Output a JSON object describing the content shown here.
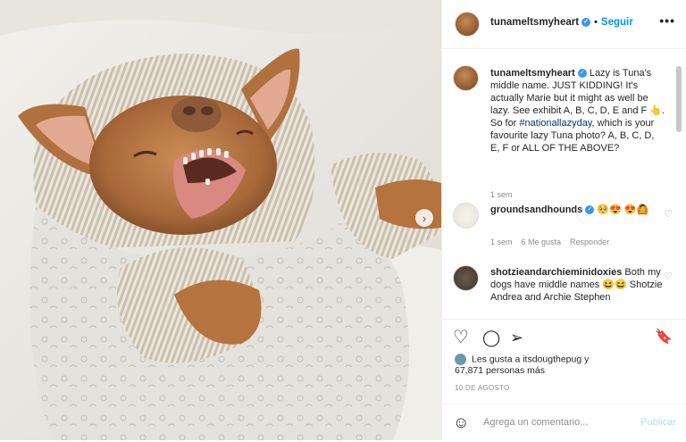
{
  "post": {
    "username": "tunameltsmyheart",
    "follow_label": "Seguir",
    "separator": "•",
    "more": "•••",
    "next_arrow": "›"
  },
  "caption": {
    "username": "tunameltsmyheart",
    "text_before": " Lazy is Tuna's middle name. JUST KIDDING! It's actually Marie but it might as well be lazy. See exhibit A, B, C, D, E and F 👆. So for ",
    "hashtag": "#nationallazyday",
    "text_after": ", which is your favourite lazy Tuna photo? A, B, C, D, E, F or ALL OF THE ABOVE?",
    "time": "1 sem"
  },
  "comments": [
    {
      "username": "groundsandhounds",
      "text": " 🥺😍 😍🙆",
      "time": "1 sem",
      "likes": "6 Me gusta",
      "reply": "Responder"
    },
    {
      "username": "shotzieandarchieminidoxies",
      "text": " Both my dogs have middle names 😆😆 Shotzie Andrea and Archie Stephen"
    }
  ],
  "actions": {
    "heart": "♡",
    "comment": "◯",
    "share": "➢",
    "bookmark": "🔖"
  },
  "likes_line1": "Les gusta a itsdougthepug y",
  "likes_line2": "67,871 personas más",
  "date": "10 DE AGOSTO",
  "add_comment": {
    "placeholder": "Agrega un comentario...",
    "publish": "Publicar",
    "emoji_icon": "☺"
  },
  "colors": {
    "accent": "#0095f6",
    "verified": "#3897f0",
    "muted": "#8e8e8e"
  }
}
